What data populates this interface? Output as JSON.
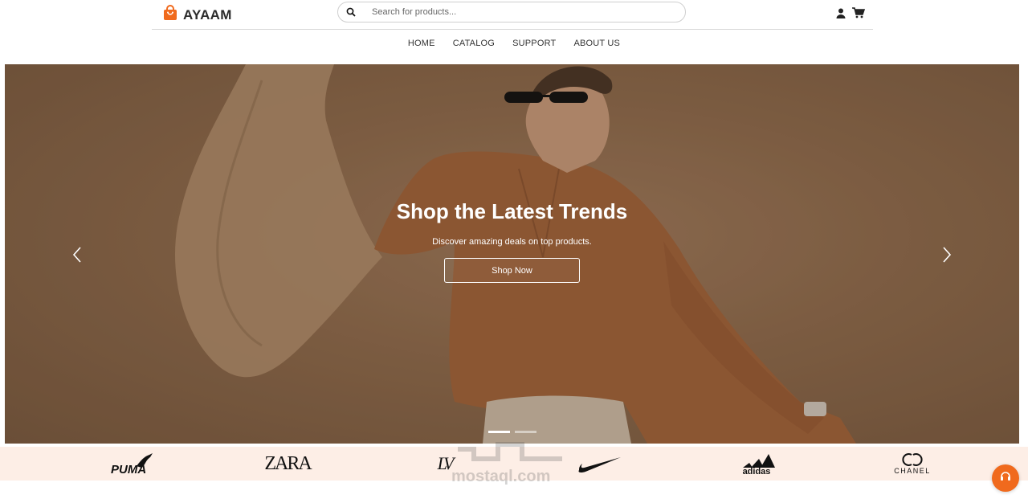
{
  "header": {
    "brand_name": "AYAAM",
    "search_placeholder": "Search for products...",
    "icons": [
      "user-icon",
      "cart-icon"
    ]
  },
  "nav": {
    "items": [
      {
        "label": "HOME"
      },
      {
        "label": "CATALOG"
      },
      {
        "label": "SUPPORT"
      },
      {
        "label": "ABOUT US"
      }
    ]
  },
  "hero": {
    "title": "Shop the Latest Trends",
    "subtitle": "Discover amazing deals on top products.",
    "cta_label": "Shop Now",
    "slides_count": 2,
    "active_slide": 1
  },
  "brands": {
    "items": [
      "PUMA",
      "ZARA",
      "LV",
      "NIKE",
      "adidas",
      "CHANEL"
    ]
  },
  "watermark": {
    "text": "mostaql.com"
  },
  "colors": {
    "accent": "#f06a1d",
    "brand_strip_bg": "#fdeee6",
    "hero_bg": "#8e6a4c"
  }
}
